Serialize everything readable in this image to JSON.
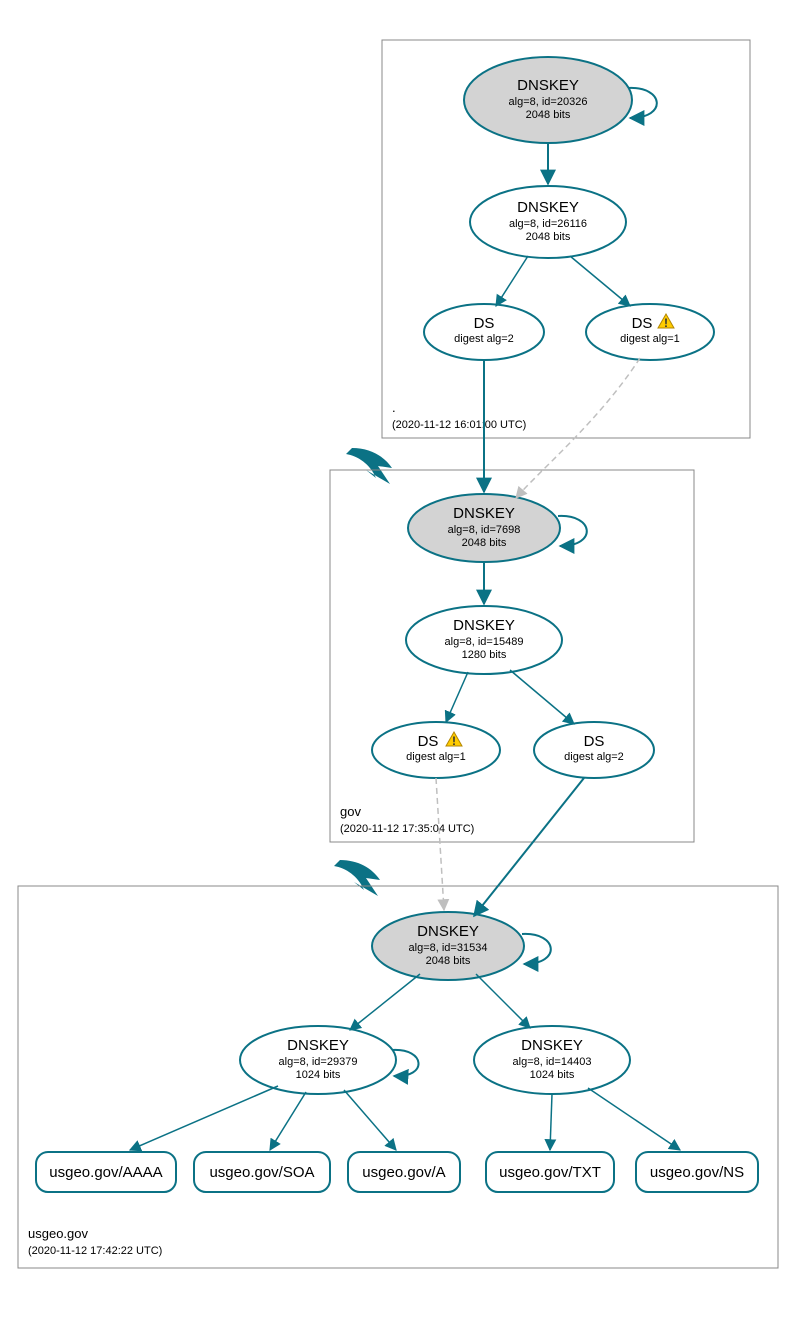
{
  "colors": {
    "accent": "#0b7285",
    "key_fill": "#d3d3d3",
    "warn": "#ffcc00"
  },
  "zones": {
    "root": {
      "label": ".",
      "time": "(2020-11-12 16:01:00 UTC)",
      "dnskey1": {
        "title": "DNSKEY",
        "l1": "alg=8, id=20326",
        "l2": "2048 bits"
      },
      "dnskey2": {
        "title": "DNSKEY",
        "l1": "alg=8, id=26116",
        "l2": "2048 bits"
      },
      "ds1": {
        "title": "DS",
        "l1": "digest alg=2"
      },
      "ds2": {
        "title": "DS",
        "l1": "digest alg=1"
      }
    },
    "gov": {
      "label": "gov",
      "time": "(2020-11-12 17:35:04 UTC)",
      "dnskey1": {
        "title": "DNSKEY",
        "l1": "alg=8, id=7698",
        "l2": "2048 bits"
      },
      "dnskey2": {
        "title": "DNSKEY",
        "l1": "alg=8, id=15489",
        "l2": "1280 bits"
      },
      "ds1": {
        "title": "DS",
        "l1": "digest alg=1"
      },
      "ds2": {
        "title": "DS",
        "l1": "digest alg=2"
      }
    },
    "usgeo": {
      "label": "usgeo.gov",
      "time": "(2020-11-12 17:42:22 UTC)",
      "dnskey1": {
        "title": "DNSKEY",
        "l1": "alg=8, id=31534",
        "l2": "2048 bits"
      },
      "dnskey2": {
        "title": "DNSKEY",
        "l1": "alg=8, id=29379",
        "l2": "1024 bits"
      },
      "dnskey3": {
        "title": "DNSKEY",
        "l1": "alg=8, id=14403",
        "l2": "1024 bits"
      },
      "rr": {
        "aaaa": "usgeo.gov/AAAA",
        "soa": "usgeo.gov/SOA",
        "a": "usgeo.gov/A",
        "txt": "usgeo.gov/TXT",
        "ns": "usgeo.gov/NS"
      }
    }
  },
  "chart_data": {
    "type": "hierarchy",
    "title": "DNSSEC authentication chain for usgeo.gov",
    "zones": [
      {
        "name": ".",
        "timestamp": "2020-11-12 16:01:00 UTC",
        "keys": [
          {
            "type": "DNSKEY",
            "alg": 8,
            "id": 20326,
            "bits": 2048,
            "role": "KSK",
            "self_signed": true
          },
          {
            "type": "DNSKEY",
            "alg": 8,
            "id": 26116,
            "bits": 2048,
            "role": "ZSK"
          }
        ],
        "ds_for_child": [
          {
            "digest_alg": 2,
            "status": "ok"
          },
          {
            "digest_alg": 1,
            "status": "warning"
          }
        ]
      },
      {
        "name": "gov",
        "timestamp": "2020-11-12 17:35:04 UTC",
        "keys": [
          {
            "type": "DNSKEY",
            "alg": 8,
            "id": 7698,
            "bits": 2048,
            "role": "KSK",
            "self_signed": true
          },
          {
            "type": "DNSKEY",
            "alg": 8,
            "id": 15489,
            "bits": 1280,
            "role": "ZSK"
          }
        ],
        "ds_for_child": [
          {
            "digest_alg": 1,
            "status": "warning"
          },
          {
            "digest_alg": 2,
            "status": "ok"
          }
        ]
      },
      {
        "name": "usgeo.gov",
        "timestamp": "2020-11-12 17:42:22 UTC",
        "keys": [
          {
            "type": "DNSKEY",
            "alg": 8,
            "id": 31534,
            "bits": 2048,
            "role": "KSK",
            "self_signed": true
          },
          {
            "type": "DNSKEY",
            "alg": 8,
            "id": 29379,
            "bits": 1024,
            "role": "ZSK",
            "self_signed": true
          },
          {
            "type": "DNSKEY",
            "alg": 8,
            "id": 14403,
            "bits": 1024,
            "role": "ZSK"
          }
        ],
        "rrsets": [
          "usgeo.gov/AAAA",
          "usgeo.gov/SOA",
          "usgeo.gov/A",
          "usgeo.gov/TXT",
          "usgeo.gov/NS"
        ]
      }
    ],
    "edges": [
      {
        "from": ".KSK20326",
        "to": ".KSK20326",
        "kind": "self"
      },
      {
        "from": ".KSK20326",
        "to": ".ZSK26116",
        "kind": "sign"
      },
      {
        "from": ".ZSK26116",
        "to": ".DS alg2",
        "kind": "sign"
      },
      {
        "from": ".ZSK26116",
        "to": ".DS alg1",
        "kind": "sign"
      },
      {
        "from": ".DS alg2",
        "to": "gov.KSK7698",
        "kind": "secure"
      },
      {
        "from": ".DS alg1",
        "to": "gov.KSK7698",
        "kind": "insecure"
      },
      {
        "from": "gov.KSK7698",
        "to": "gov.KSK7698",
        "kind": "self"
      },
      {
        "from": "gov.KSK7698",
        "to": "gov.ZSK15489",
        "kind": "sign"
      },
      {
        "from": "gov.ZSK15489",
        "to": "gov.DS alg1",
        "kind": "sign"
      },
      {
        "from": "gov.ZSK15489",
        "to": "gov.DS alg2",
        "kind": "sign"
      },
      {
        "from": "gov.DS alg1",
        "to": "usgeo.KSK31534",
        "kind": "insecure"
      },
      {
        "from": "gov.DS alg2",
        "to": "usgeo.KSK31534",
        "kind": "secure"
      },
      {
        "from": "usgeo.KSK31534",
        "to": "usgeo.KSK31534",
        "kind": "self"
      },
      {
        "from": "usgeo.KSK31534",
        "to": "usgeo.ZSK29379",
        "kind": "sign"
      },
      {
        "from": "usgeo.KSK31534",
        "to": "usgeo.ZSK14403",
        "kind": "sign"
      },
      {
        "from": "usgeo.ZSK29379",
        "to": "usgeo.ZSK29379",
        "kind": "self"
      },
      {
        "from": "usgeo.ZSK29379",
        "to": "usgeo.gov/AAAA",
        "kind": "sign"
      },
      {
        "from": "usgeo.ZSK29379",
        "to": "usgeo.gov/SOA",
        "kind": "sign"
      },
      {
        "from": "usgeo.ZSK29379",
        "to": "usgeo.gov/A",
        "kind": "sign"
      },
      {
        "from": "usgeo.ZSK14403",
        "to": "usgeo.gov/TXT",
        "kind": "sign"
      },
      {
        "from": "usgeo.ZSK14403",
        "to": "usgeo.gov/NS",
        "kind": "sign"
      }
    ]
  }
}
